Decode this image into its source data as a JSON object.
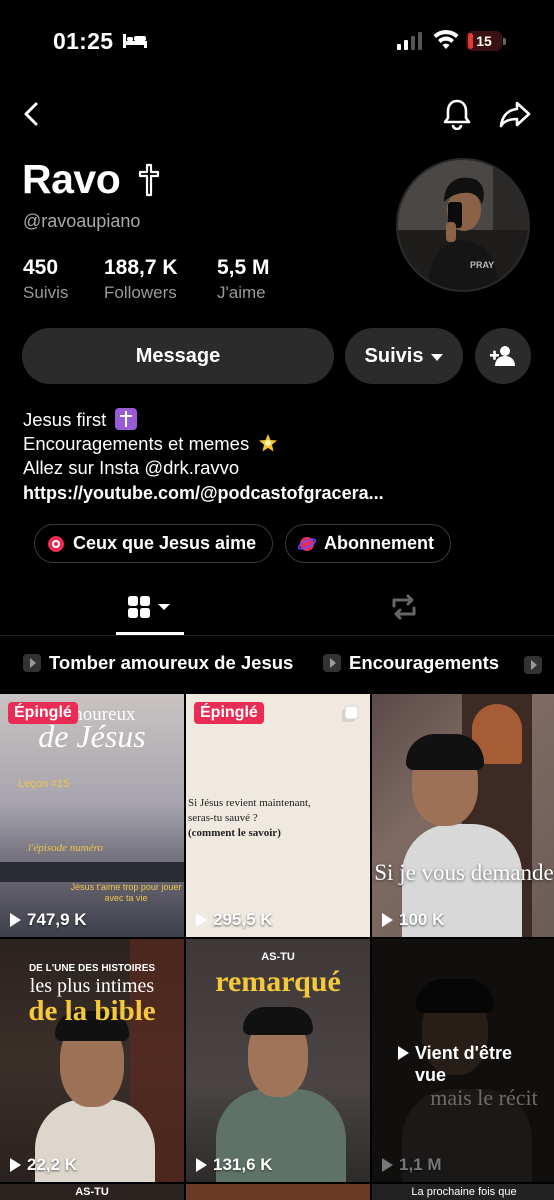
{
  "status": {
    "time": "01:25",
    "battery": "15",
    "battery_level_percent": 15
  },
  "profile": {
    "name": "Ravo",
    "handle": "@ravoaupiano",
    "stats": [
      {
        "value": "450",
        "label": "Suivis"
      },
      {
        "value": "188,7 K",
        "label": "Followers"
      },
      {
        "value": "5,5 M",
        "label": "J'aime"
      }
    ]
  },
  "actions": {
    "message": "Message",
    "follow": "Suivis"
  },
  "bio": {
    "line1": "Jesus first",
    "line2": "Encouragements et memes",
    "line3": "Allez sur Insta @drk.ravvo",
    "link": "https://youtube.com/@podcastofgracera..."
  },
  "chips": [
    {
      "label": "Ceux que Jesus aime"
    },
    {
      "label": "Abonnement"
    }
  ],
  "playlists": [
    {
      "label": "Tomber amoureux de Jesus"
    },
    {
      "label": "Encouragements"
    }
  ],
  "videos": [
    {
      "pinned": "Épinglé",
      "views": "747,9 K",
      "title_top": "er amoureux",
      "title_main": "de Jésus",
      "lesson": "Leçon #15",
      "episode": "l'épisode numéro",
      "caption": "Jésus t'aime trop pour jouer avec ta vie"
    },
    {
      "pinned": "Épinglé",
      "views": "295,5 K",
      "text1": "Si Jésus revient maintenant,",
      "text2": "seras-tu sauvé ?",
      "text3": "(comment le savoir)"
    },
    {
      "views": "100 K",
      "caption": "Si je vous demande"
    },
    {
      "views": "22,2 K",
      "top": "DE L'UNE DES HISTOIRES",
      "mid": "les plus intimes",
      "main": "de la bible"
    },
    {
      "views": "131,6 K",
      "top": "AS-TU",
      "main": "remarqué"
    },
    {
      "views": "1,1 M",
      "watched": "Vient d'être vue",
      "caption": "mais le récit"
    }
  ],
  "bottom_row": {
    "left": "AS-TU",
    "right": "La prochaine fois que"
  },
  "colors": {
    "pinned": "#ea2c55",
    "button": "#2b2b2b",
    "battery": "#e23a3a"
  }
}
